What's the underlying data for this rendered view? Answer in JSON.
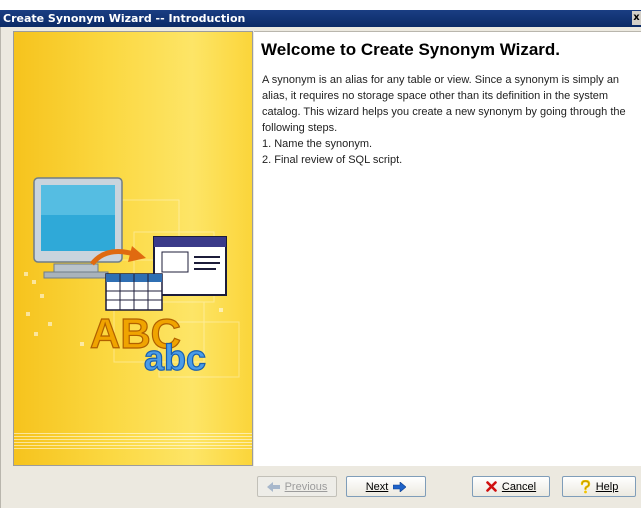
{
  "window": {
    "title": "Create Synonym Wizard -- Introduction",
    "close_glyph": "x"
  },
  "banner": {
    "art_text_upper": "ABC",
    "art_text_lower": "abc",
    "background_color": "#fbd841"
  },
  "content": {
    "title": "Welcome to Create Synonym Wizard.",
    "description": "A synonym is an alias for any table or view. Since a synonym is simply an alias, it requires no storage space other than its definition in the system catalog. This wizard helps you create a new synonym by going through the following steps.",
    "steps": [
      "1. Name the synonym.",
      "2. Final review of SQL script."
    ]
  },
  "buttons": {
    "previous": {
      "label": "Previous",
      "icon": "left-arrow-icon",
      "enabled": false
    },
    "next": {
      "label": "Next",
      "icon": "right-arrow-icon",
      "enabled": true
    },
    "cancel": {
      "label": "Cancel",
      "icon": "red-x-icon",
      "enabled": true
    },
    "help": {
      "label": "Help",
      "icon": "question-mark-icon",
      "enabled": true
    }
  },
  "colors": {
    "titlebar": "#0b2a66",
    "arrow_blue": "#1e62c8",
    "cancel_red": "#d01010",
    "help_yellow": "#f2c500"
  }
}
